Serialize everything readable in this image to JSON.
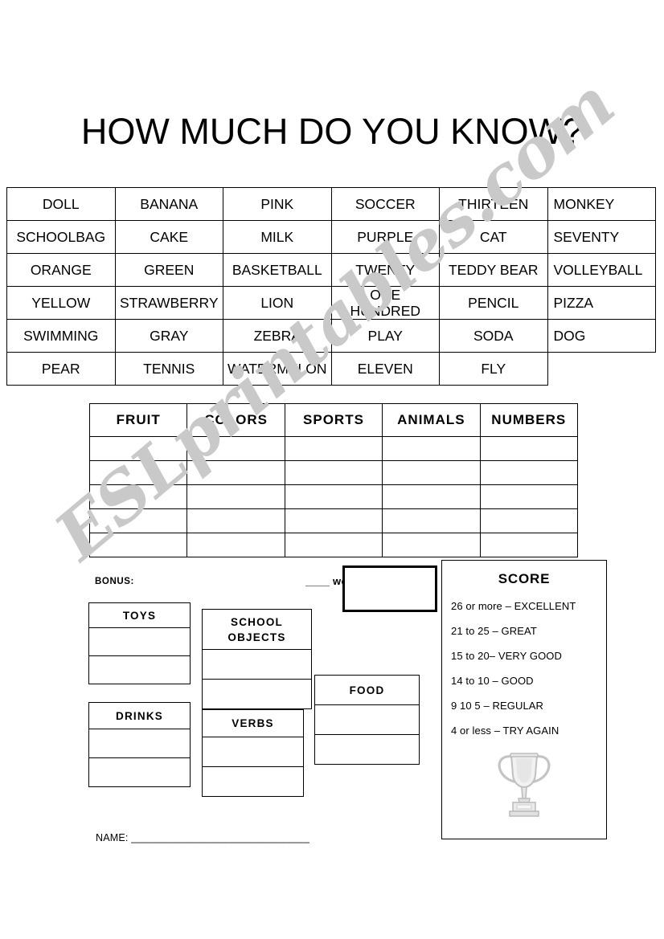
{
  "page": {
    "title": "HOW MUCH DO YOU KNOW?",
    "watermark": "ESLprintables.com",
    "watermark_color": "#c9c9c9"
  },
  "words_table": {
    "rows": [
      [
        "DOLL",
        "BANANA",
        "PINK",
        "SOCCER",
        "THIRTEEN",
        "MONKEY"
      ],
      [
        "SCHOOLBAG",
        "CAKE",
        "MILK",
        "PURPLE",
        "CAT",
        "SEVENTY"
      ],
      [
        "ORANGE",
        "GREEN",
        "BASKETBALL",
        "TWENTY",
        "TEDDY BEAR",
        "VOLLEYBALL"
      ],
      [
        "YELLOW",
        "STRAWBERRY",
        "LION",
        "ONE HUNDRED",
        "PENCIL",
        "PIZZA"
      ],
      [
        "SWIMMING",
        "GRAY",
        "ZEBRA",
        "PLAY",
        "SODA",
        "DOG"
      ],
      [
        "PEAR",
        "TENNIS",
        "WATERMELON",
        "ELEVEN",
        "FLY",
        ""
      ]
    ]
  },
  "categories_table": {
    "headers": [
      "FRUIT",
      "COLORS",
      "SPORTS",
      "ANIMALS",
      "NUMBERS"
    ],
    "empty_rows": 5
  },
  "bonus": {
    "label": "BONUS:",
    "words_label": "____ words",
    "words_value": "",
    "boxes": [
      {
        "key": "toys",
        "header": "TOYS",
        "rows": 2
      },
      {
        "key": "school_objects",
        "header": "SCHOOL OBJECTS",
        "header_line1": "SCHOOL",
        "header_line2": "OBJECTS",
        "rows": 2
      },
      {
        "key": "food",
        "header": "FOOD",
        "rows": 2
      },
      {
        "key": "drinks",
        "header": "DRINKS",
        "rows": 2
      },
      {
        "key": "verbs",
        "header": "VERBS",
        "rows": 2
      }
    ]
  },
  "score": {
    "title": "SCORE",
    "lines": [
      "26 or more – EXCELLENT",
      "21 to 25 – GREAT",
      "15 to 20– VERY GOOD",
      "14 to 10 – GOOD",
      "9 10 5 – REGULAR",
      "4 or less – TRY AGAIN"
    ],
    "trophy_icon": "trophy-icon"
  },
  "footer": {
    "name_line": "NAME: _______________________________"
  }
}
